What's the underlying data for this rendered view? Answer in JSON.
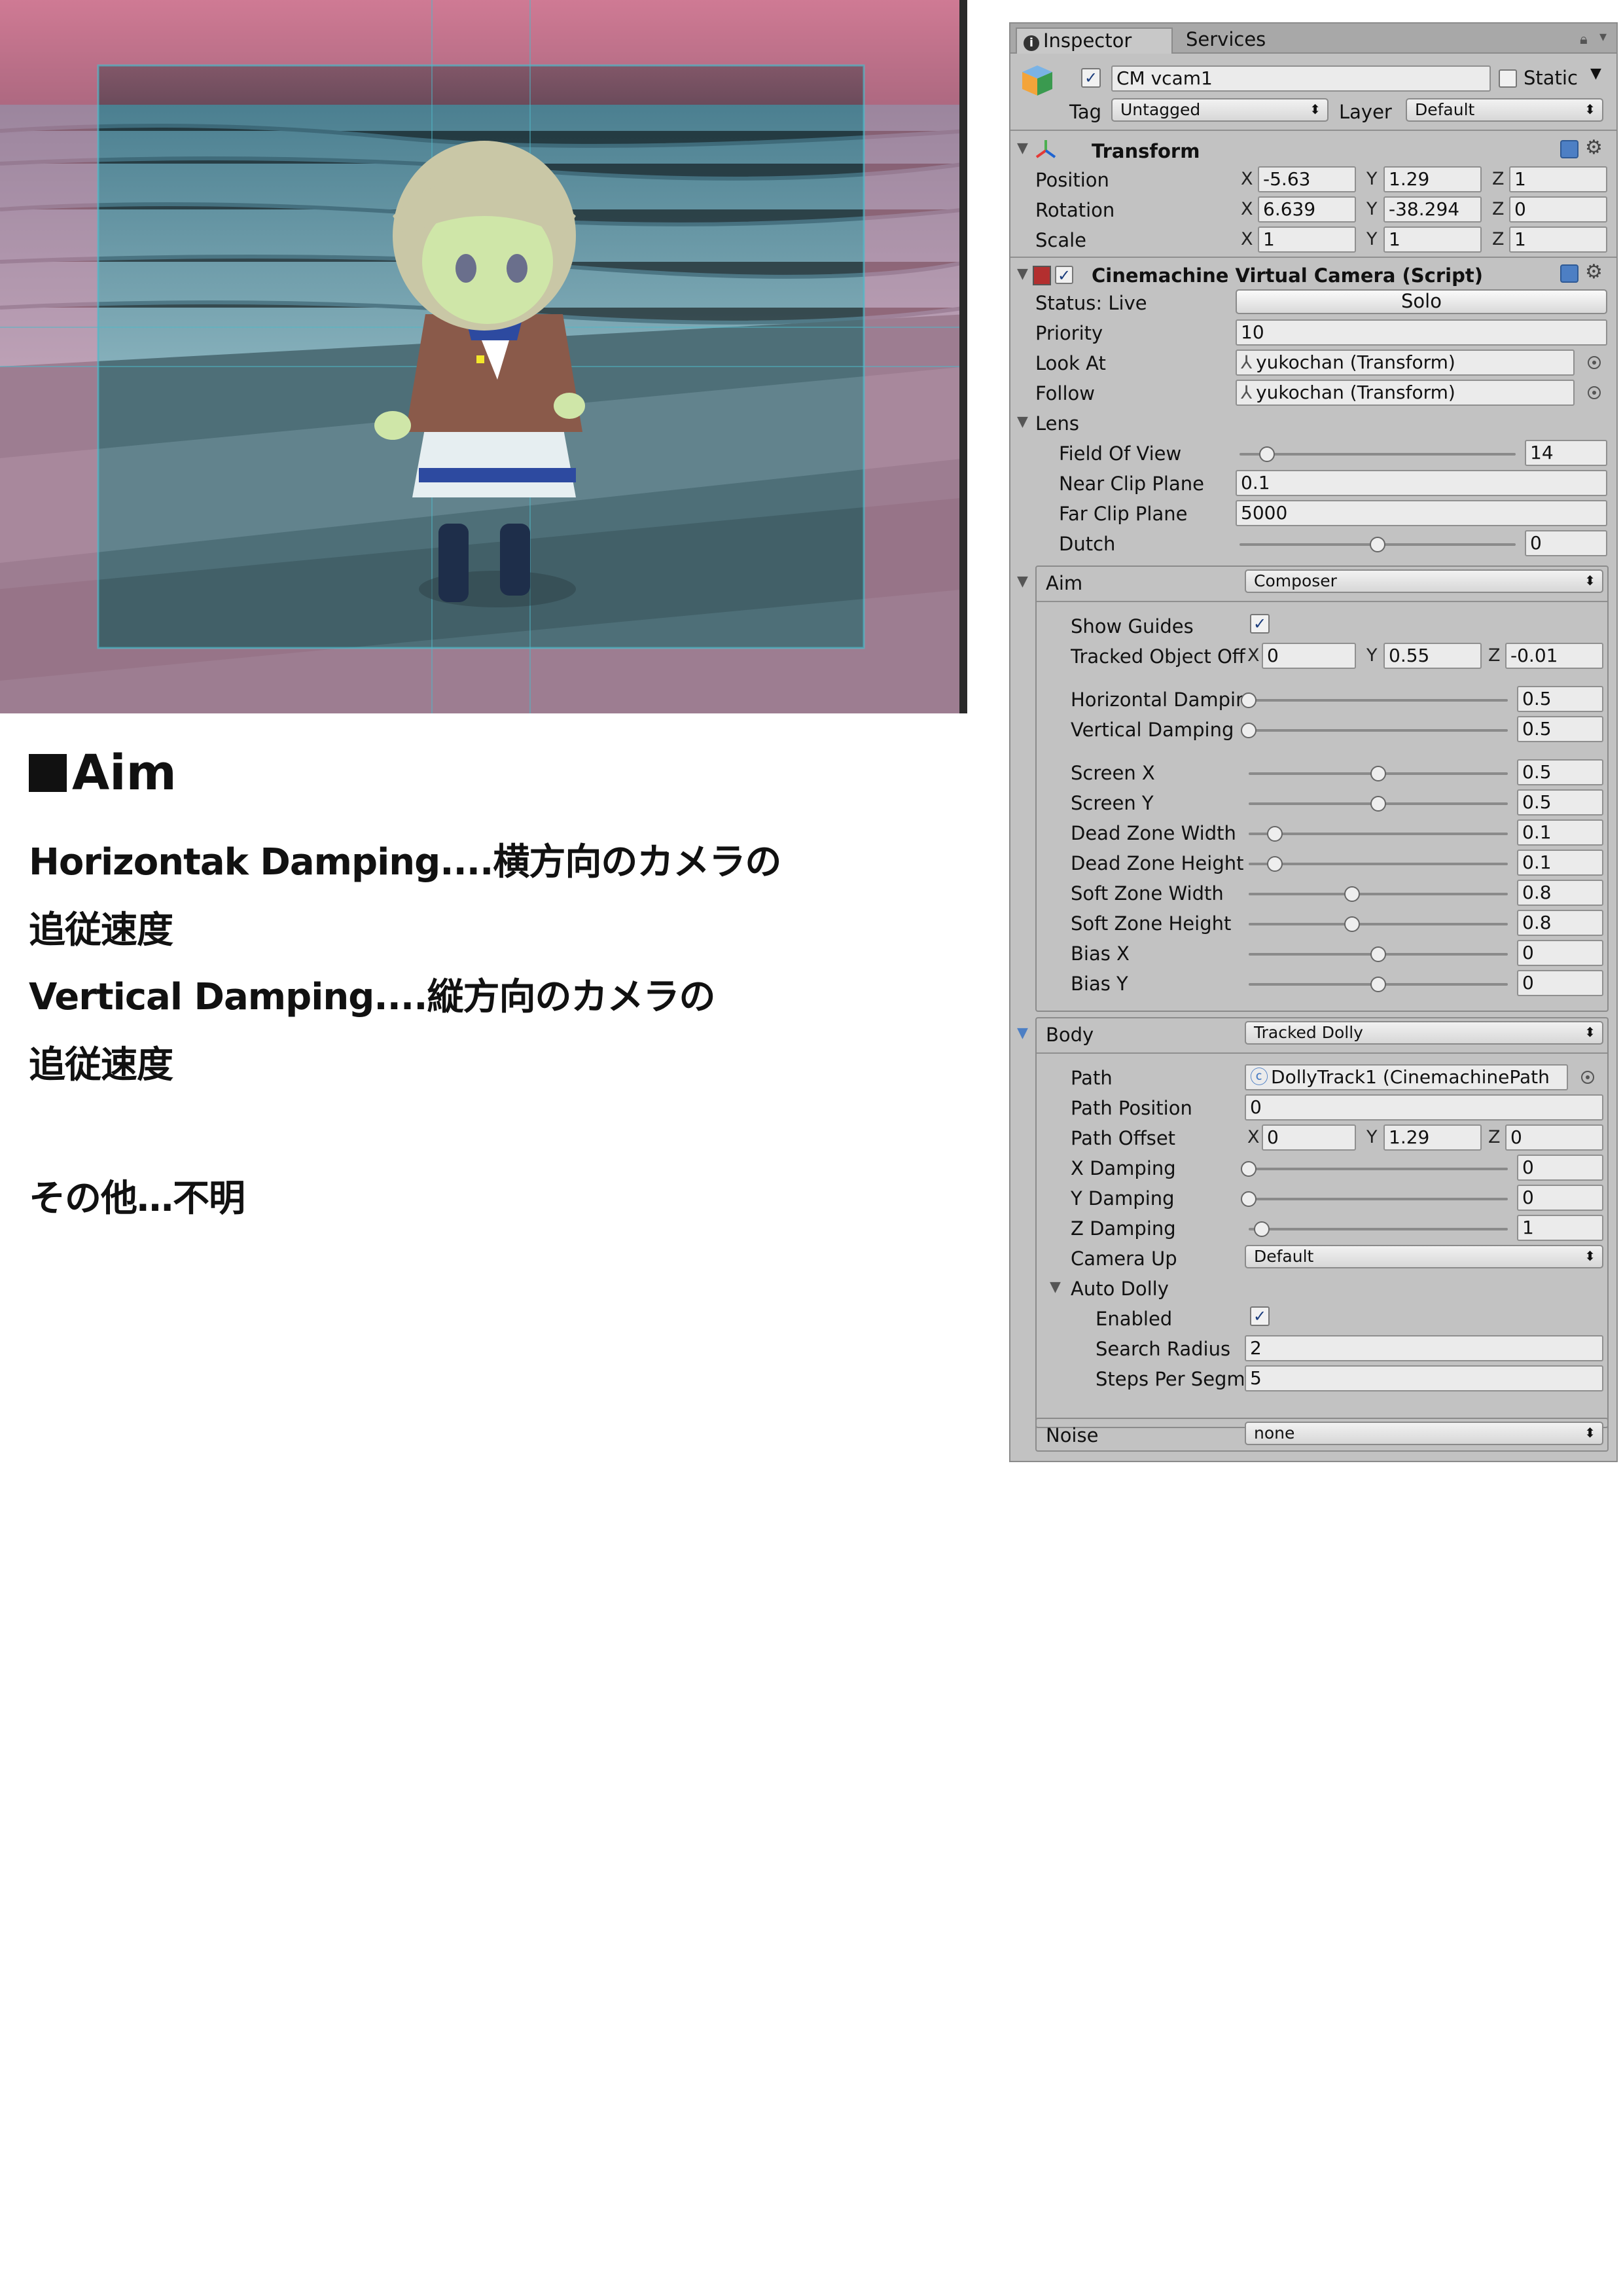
{
  "notes": {
    "heading": "Aim",
    "lines": [
      "Horizontak Damping....横方向のカメラの",
      "追従速度",
      "Vertical Damping....縦方向のカメラの",
      "追従速度",
      "その他…不明"
    ]
  },
  "inspector": {
    "tabs": [
      "Inspector",
      "Services"
    ],
    "object": {
      "name": "CM vcam1",
      "active": true,
      "static_label": "Static",
      "static": false,
      "tag_label": "Tag",
      "tag": "Untagged",
      "layer_label": "Layer",
      "layer": "Default"
    },
    "transform": {
      "title": "Transform",
      "rows": [
        {
          "label": "Position",
          "x": "-5.63",
          "y": "1.29",
          "z": "1"
        },
        {
          "label": "Rotation",
          "x": "6.639",
          "y": "-38.294",
          "z": "0"
        },
        {
          "label": "Scale",
          "x": "1",
          "y": "1",
          "z": "1"
        }
      ]
    },
    "vcam": {
      "title": "Cinemachine Virtual Camera (Script)",
      "status": "Status: Live",
      "solo": "Solo",
      "priority_label": "Priority",
      "priority": "10",
      "look_at_label": "Look At",
      "look_at": "yukochan (Transform)",
      "follow_label": "Follow",
      "follow": "yukochan (Transform)",
      "lens_label": "Lens",
      "fov_label": "Field Of View",
      "fov": "14",
      "fov_slider": 0.1,
      "near_label": "Near Clip Plane",
      "near": "0.1",
      "far_label": "Far Clip Plane",
      "far": "5000",
      "dutch_label": "Dutch",
      "dutch": "0",
      "dutch_slider": 0.5
    },
    "aim": {
      "label": "Aim",
      "mode": "Composer",
      "show_guides_label": "Show Guides",
      "show_guides": true,
      "tracked_offset_label": "Tracked Object Off",
      "tracked_offset": {
        "x": "0",
        "y": "0.55",
        "z": "-0.01"
      },
      "sliders": [
        {
          "label": "Horizontal Damping",
          "value": "0.5",
          "fraction": 0.0
        },
        {
          "label": "Vertical Damping",
          "value": "0.5",
          "fraction": 0.0
        },
        {
          "label": "Screen X",
          "value": "0.5",
          "fraction": 0.5
        },
        {
          "label": "Screen Y",
          "value": "0.5",
          "fraction": 0.5
        },
        {
          "label": "Dead Zone Width",
          "value": "0.1",
          "fraction": 0.1
        },
        {
          "label": "Dead Zone Height",
          "value": "0.1",
          "fraction": 0.1
        },
        {
          "label": "Soft Zone Width",
          "value": "0.8",
          "fraction": 0.4
        },
        {
          "label": "Soft Zone Height",
          "value": "0.8",
          "fraction": 0.4
        },
        {
          "label": "Bias X",
          "value": "0",
          "fraction": 0.5
        },
        {
          "label": "Bias Y",
          "value": "0",
          "fraction": 0.5
        }
      ]
    },
    "body": {
      "label": "Body",
      "mode": "Tracked Dolly",
      "path_label": "Path",
      "path": "DollyTrack1 (CinemachinePath",
      "path_position_label": "Path Position",
      "path_position": "0",
      "path_offset_label": "Path Offset",
      "path_offset": {
        "x": "0",
        "y": "1.29",
        "z": "0"
      },
      "dampings": [
        {
          "label": "X Damping",
          "value": "0",
          "fraction": 0.0
        },
        {
          "label": "Y Damping",
          "value": "0",
          "fraction": 0.0
        },
        {
          "label": "Z Damping",
          "value": "1",
          "fraction": 0.05
        }
      ],
      "camera_up_label": "Camera Up",
      "camera_up": "Default",
      "auto_dolly_label": "Auto Dolly",
      "enabled_label": "Enabled",
      "enabled": true,
      "search_radius_label": "Search Radius",
      "search_radius": "2",
      "steps_label": "Steps Per Segm",
      "steps": "5"
    },
    "noise": {
      "label": "Noise",
      "mode": "none"
    }
  }
}
